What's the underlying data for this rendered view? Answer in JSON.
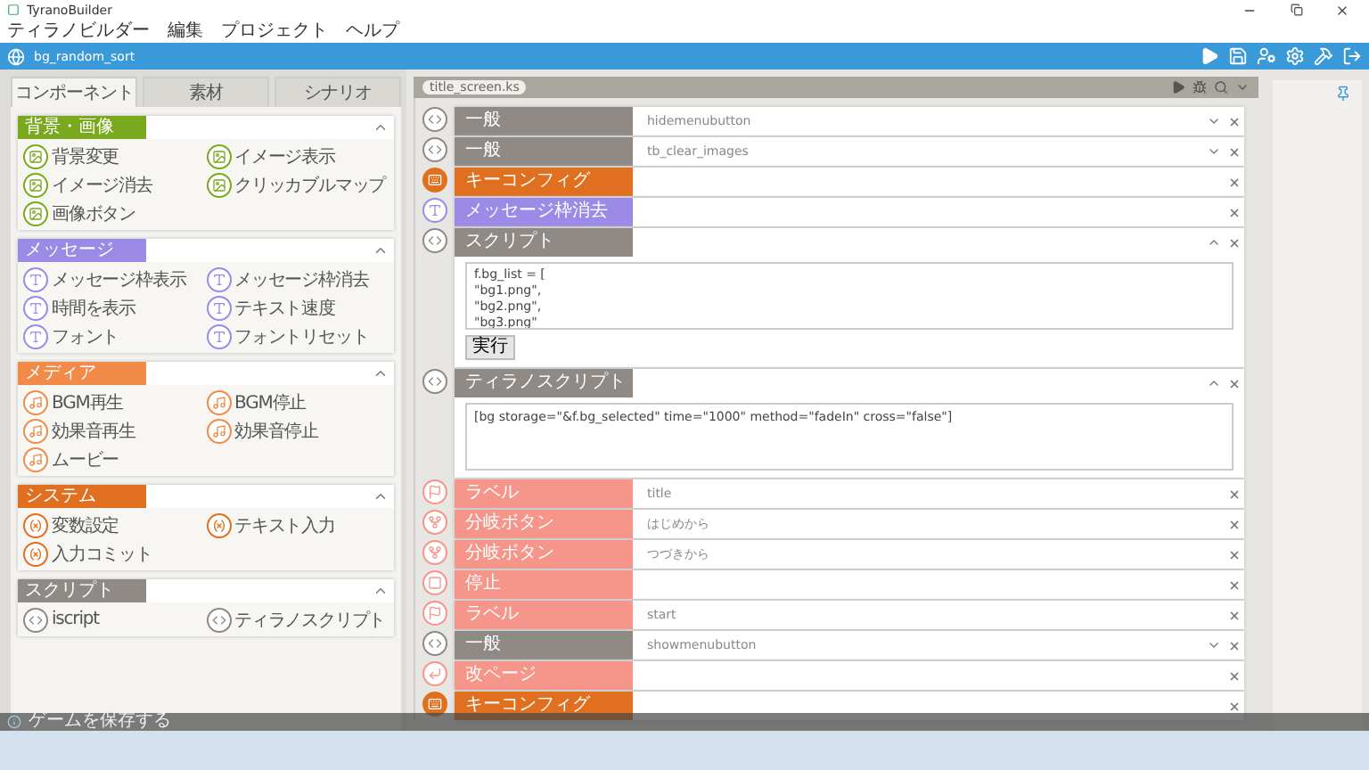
{
  "window": {
    "title": "TyranoBuilder"
  },
  "menu": [
    "ティラノビルダー",
    "編集",
    "プロジェクト",
    "ヘルプ"
  ],
  "project": {
    "name": "bg_random_sort"
  },
  "tabs": [
    {
      "label": "コンポーネント",
      "selected": true
    },
    {
      "label": "素材",
      "selected": false
    },
    {
      "label": "シナリオ",
      "selected": false
    }
  ],
  "palette": [
    {
      "title": "背景・画像",
      "kind": "image",
      "color": "#7aa81e",
      "expanded": true,
      "items": [
        "背景変更",
        "イメージ表示",
        "イメージ消去",
        "クリッカブルマップ",
        "画像ボタン"
      ]
    },
    {
      "title": "メッセージ",
      "kind": "message",
      "color": "#9b8ae6",
      "expanded": true,
      "items": [
        "メッセージ枠表示",
        "メッセージ枠消去",
        "時間を表示",
        "テキスト速度",
        "フォント",
        "フォントリセット"
      ]
    },
    {
      "title": "メディア",
      "kind": "media",
      "color": "#f28a4a",
      "expanded": true,
      "items": [
        "BGM再生",
        "BGM停止",
        "効果音再生",
        "効果音停止",
        "ムービー"
      ]
    },
    {
      "title": "システム",
      "kind": "system",
      "color": "#e07020",
      "expanded": true,
      "items": [
        "変数設定",
        "テキスト入力",
        "入力コミット"
      ]
    },
    {
      "title": "スクリプト",
      "kind": "script",
      "color": "#8f8a85",
      "expanded": true,
      "items": [
        "iscript",
        "ティラノスクリプト"
      ]
    }
  ],
  "editor": {
    "file": "title_screen.ks",
    "blocks": [
      {
        "kind": "general",
        "label": "一般",
        "color": "#8f8a85",
        "value": "hidemenubutton",
        "dropdown": true
      },
      {
        "kind": "general",
        "label": "一般",
        "color": "#8f8a85",
        "value": "tb_clear_images",
        "dropdown": true
      },
      {
        "kind": "keyconfig",
        "label": "キーコンフィグ",
        "color": "#e07020",
        "dropdown": false
      },
      {
        "kind": "message",
        "label": "メッセージ枠消去",
        "color": "#9b8ae6",
        "dropdown": false
      },
      {
        "kind": "script",
        "label": "スクリプト",
        "color": "#8f8a85",
        "expanded": true,
        "lines": [
          "f.bg_list = [",
          "\"bg1.png\",",
          "\"bg2.png\",",
          "\"bg3.png\""
        ],
        "run": "実行"
      },
      {
        "kind": "tyrano",
        "label": "ティラノスクリプト",
        "color": "#8f8a85",
        "expanded": true,
        "value": "[bg storage=\"&f.bg_selected\" time=\"1000\" method=\"fadeIn\" cross=\"false\"]"
      },
      {
        "kind": "label",
        "label": "ラベル",
        "color": "#f6958a",
        "value": "title",
        "dropdown": false
      },
      {
        "kind": "branch",
        "label": "分岐ボタン",
        "color": "#f6958a",
        "value": "はじめから",
        "dropdown": false
      },
      {
        "kind": "branch",
        "label": "分岐ボタン",
        "color": "#f6958a",
        "value": "つづきから",
        "dropdown": false
      },
      {
        "kind": "stop",
        "label": "停止",
        "color": "#f6958a",
        "dropdown": false
      },
      {
        "kind": "label",
        "label": "ラベル",
        "color": "#f6958a",
        "value": "start",
        "dropdown": false
      },
      {
        "kind": "general",
        "label": "一般",
        "color": "#8f8a85",
        "value": "showmenubutton",
        "dropdown": true
      },
      {
        "kind": "page",
        "label": "改ページ",
        "color": "#f6958a",
        "dropdown": false
      },
      {
        "kind": "keyconfig",
        "label": "キーコンフィグ",
        "color": "#e07020",
        "dropdown": false
      }
    ]
  },
  "status_bar": {
    "text": "ゲームを保存する"
  }
}
